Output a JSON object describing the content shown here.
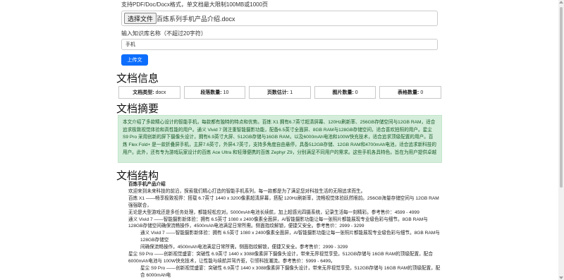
{
  "upload": {
    "hint": "支持PDF/Doc/Docx格式，单文档最大限制100MB或1000页",
    "choose_button": "选择文件",
    "file_name": "百炼系列手机产品介绍.docx",
    "name_label": "输入知识库名称（不超过20字符）",
    "name_value": "手机",
    "upload_button": "上传文件"
  },
  "info": {
    "heading": "文档信息",
    "stats": [
      {
        "label": "文档类型:",
        "value": "docx"
      },
      {
        "label": "段落数量:",
        "value": "10"
      },
      {
        "label": "页数估计:",
        "value": "1"
      },
      {
        "label": "图片数量:",
        "value": "0"
      },
      {
        "label": "表格数量:",
        "value": "0"
      }
    ]
  },
  "summary": {
    "heading": "文档摘要",
    "text": "本文介绍了多款精心设计的智能手机，每款都有独特的特点和优势。百炼 X1 拥有6.7英寸超清屏幕、120Hz刷新率、256GB存储空间与12GB RAM，适合追求极致视觉体验和高性能的用户。通义 Vivid 7 则注重智能摄影功能，配备6.5英寸全面屏、8GB RAM与128GB存储空间，适合喜欢拍照的用户。星尘 S9 Pro 采用创新的屏下摄像头设计，拥有6.9英寸大屏、512GB存储与16GB RAM，以及6000mAh电池和100W快充技术，适合追求顶级配置的用户。百炼 Flex Fold+ 是一款折叠屏手机，主屏7.6英寸，外屏4.7英寸，支持多角度自由悬停，具备512GB存储、12GB RAM和4700mAh电池，适合追求新科技的用户。此外，还有专为游戏玩家设计的百炼 Ace Ultra 和轻薄便携的百炼 Zephyr Z9，分别满足不同用户的需求。这些手机各具特色，旨在为用户提供卓越"
  },
  "structure": {
    "heading": "文档结构",
    "title": "百炼手机产品介绍",
    "lines": [
      {
        "text": "欢迎来到未来科技的前沿，探索我们精心打造的智能手机系列，每一款都是为了满足您对科技生活的无限追求而生。",
        "indent": false
      },
      {
        "text": "百炼 X1 ——畅享极致视界：搭载 6.7英寸 1440 x 3200像素超清屏幕，搭配 120Hz刷新率，流畅视觉体验跃然眼前。256GB海量存储空间与 12GB RAM强强联合，",
        "indent": false
      },
      {
        "text": "无论是大型游戏还是多任务处理，都能轻松应对。5000mAh电池长续航，加上超感光四摄系统，记录生活每一刻精彩。参考售价：4599 - 4999",
        "indent": false
      },
      {
        "text": "通义 Vivid 7 ——智能摄影新体验：拥有 6.5英寸 1080 x 2400像素全面屏，AI智能摄影功能让每一张照片都能展现专业级色彩与细节。8GB RAM与 128GB存储空间确保流畅操作，4500mAh电池满足日常所需。侧面指纹解锁，便捷又安全。参考售价：2999 - 3299",
        "indent": false
      },
      {
        "text": "通义 Vivid 7 ——智能摄影新体验：拥有 6.5英寸 1080 x 2400像素全面屏，AI智能摄影功能让每一张照片都能展现专业级色彩与细节。8GB RAM与 128GB存储空",
        "indent": true
      },
      {
        "text": "间确保流畅操作，4500mAh电池满足日常所需。侧面指纹解锁，便捷又安全。参考售价：2999 - 3299",
        "indent": true
      },
      {
        "text": "星尘 S9 Pro ——创新视觉盛宴：突破性 6.9英寸 1440 x 3088像素屏下摄像头设计，带来无界视觉享受。512GB存储与 16GB RAM的顶级配置，配合 6000mAh电池与 100W快充技术，让性能与续航并驾齐驱，引领科技潮流。参考售价：5999 - 6499。",
        "indent": false
      },
      {
        "text": "星尘 S9 Pro ——创新视觉盛宴：突破性 6.9英寸 1440 x 3088像素屏下摄像头设计，带来无界视觉享受。512GB存储与 16GB RAM的顶级配置，配合 6000mAh电",
        "indent": true
      }
    ]
  }
}
